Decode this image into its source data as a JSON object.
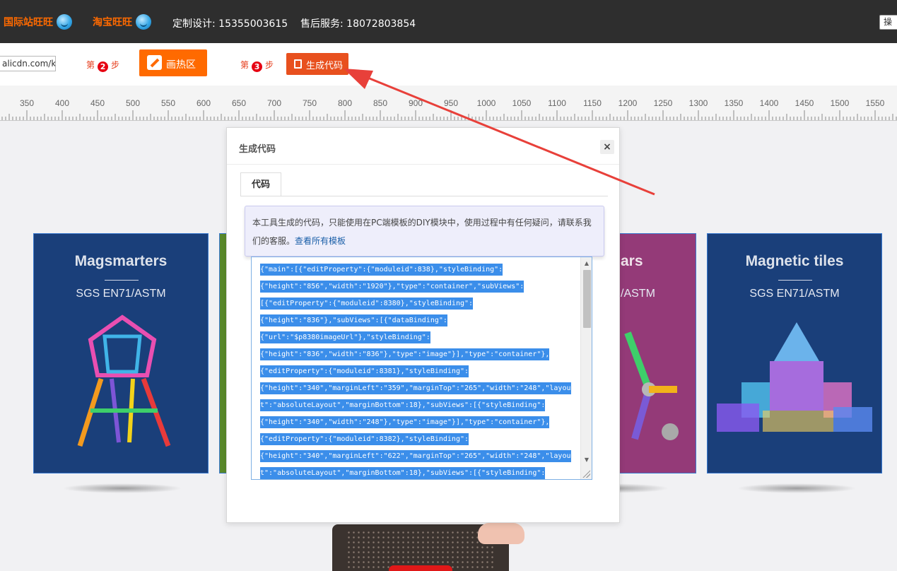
{
  "topbar": {
    "intl_wangwang": "国际站旺旺",
    "taobao_wangwang": "淘宝旺旺",
    "custom_design": "定制设计: 15355003615",
    "after_sales": "售后服务: 18072803854",
    "right_button": "操"
  },
  "stepbar": {
    "url_value": "alicdn.com/kf/",
    "step2_prefix": "第",
    "step2_num": "2",
    "step2_suffix": "步",
    "draw_hotspot_label": "画热区",
    "step3_prefix": "第",
    "step3_num": "3",
    "step3_suffix": "步",
    "generate_code_label": "生成代码"
  },
  "ruler": {
    "ticks": [
      "350",
      "400",
      "450",
      "500",
      "550",
      "600",
      "650",
      "700",
      "750",
      "800",
      "850",
      "900",
      "950",
      "1000",
      "1050",
      "1100",
      "1150",
      "1200",
      "1250",
      "1300",
      "1350",
      "1400",
      "1450",
      "1500",
      "1550"
    ]
  },
  "cards": [
    {
      "title": "Magsmarters",
      "subtitle": "SGS EN71/ASTM"
    },
    {
      "title": "",
      "subtitle": ""
    },
    {
      "title": "ars",
      "subtitle": "/ASTM"
    },
    {
      "title": "Magnetic tiles",
      "subtitle": "SGS EN71/ASTM"
    }
  ],
  "modal": {
    "title": "生成代码",
    "close": "×",
    "tab": "代码",
    "notice_text": "本工具生成的代码，只能使用在PC端模板的DIY模块中，使用过程中有任何疑问，请联系我们的客服。",
    "notice_link": "查看所有模板",
    "code_lines": [
      "{\"main\":[{\"editProperty\":{\"moduleid\":838},\"styleBinding\":",
      "{\"height\":\"856\",\"width\":\"1920\"},\"type\":\"container\",\"subViews\":",
      "[{\"editProperty\":{\"moduleid\":8380},\"styleBinding\":",
      "{\"height\":\"836\"},\"subViews\":[{\"dataBinding\":",
      "{\"url\":\"$p8380imageUrl\"},\"styleBinding\":",
      "{\"height\":\"836\",\"width\":\"836\"},\"type\":\"image\"}],\"type\":\"container\"},",
      "{\"editProperty\":{\"moduleid\":8381},\"styleBinding\":",
      "{\"height\":\"340\",\"marginLeft\":\"359\",\"marginTop\":\"265\",\"width\":\"248\",\"layou",
      "t\":\"absoluteLayout\",\"marginBottom\":18},\"subViews\":[{\"styleBinding\":",
      "{\"height\":\"340\",\"width\":\"248\"},\"type\":\"image\"}],\"type\":\"container\"},",
      "{\"editProperty\":{\"moduleid\":8382},\"styleBinding\":",
      "{\"height\":\"340\",\"marginLeft\":\"622\",\"marginTop\":\"265\",\"width\":\"248\",\"layou",
      "t\":\"absoluteLayout\",\"marginBottom\":18},\"subViews\":[{\"styleBinding\":"
    ]
  },
  "colors": {
    "accent": "#ff6a00",
    "step_red": "#e60012",
    "arrow": "#e8403a",
    "selection": "#3b8eea"
  }
}
